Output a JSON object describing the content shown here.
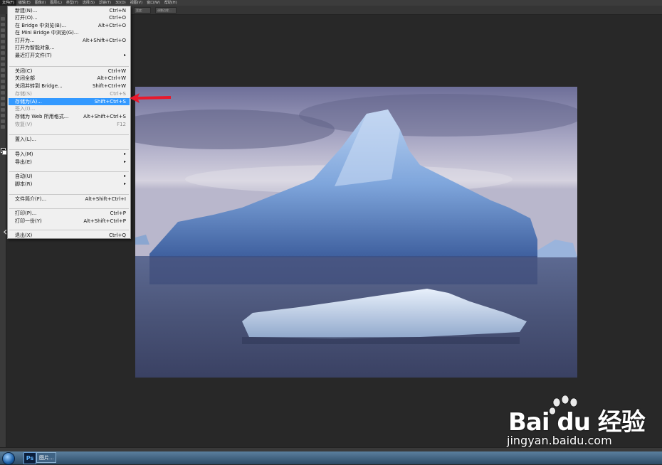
{
  "menubar": {
    "items": [
      {
        "label": "文件(F)",
        "active": true
      },
      {
        "label": "编辑(E)"
      },
      {
        "label": "图像(I)"
      },
      {
        "label": "图层(L)"
      },
      {
        "label": "类型(Y)"
      },
      {
        "label": "选择(S)"
      },
      {
        "label": "滤镜(T)"
      },
      {
        "label": "3D(D)"
      },
      {
        "label": "视图(V)"
      },
      {
        "label": "窗口(W)"
      },
      {
        "label": "帮助(H)"
      }
    ]
  },
  "options_bar": {
    "field1": "宽度:",
    "field2": "调整边缘..."
  },
  "file_menu": {
    "items": [
      {
        "label": "新建(N)...",
        "shortcut": "Ctrl+N"
      },
      {
        "label": "打开(O)...",
        "shortcut": "Ctrl+O"
      },
      {
        "label": "在 Bridge 中浏览(B)...",
        "shortcut": "Alt+Ctrl+O"
      },
      {
        "label": "在 Mini Bridge 中浏览(G)...",
        "shortcut": ""
      },
      {
        "label": "打开为...",
        "shortcut": "Alt+Shift+Ctrl+O"
      },
      {
        "label": "打开为智能对象...",
        "shortcut": ""
      },
      {
        "label": "最近打开文件(T)",
        "shortcut": "",
        "submenu": true
      },
      {
        "label": "关闭(C)",
        "shortcut": "Ctrl+W"
      },
      {
        "label": "关闭全部",
        "shortcut": "Alt+Ctrl+W"
      },
      {
        "label": "关闭并转到 Bridge...",
        "shortcut": "Shift+Ctrl+W"
      },
      {
        "label": "存储(S)",
        "shortcut": "Ctrl+S",
        "disabled": true
      },
      {
        "label": "存储为(A)...",
        "shortcut": "Shift+Ctrl+S",
        "highlight": true
      },
      {
        "label": "签入(I)...",
        "shortcut": "",
        "disabled": true
      },
      {
        "label": "存储为 Web 所用格式...",
        "shortcut": "Alt+Shift+Ctrl+S"
      },
      {
        "label": "恢复(V)",
        "shortcut": "F12",
        "disabled": true
      },
      {
        "label": "置入(L)...",
        "shortcut": ""
      },
      {
        "label": "导入(M)",
        "shortcut": "",
        "submenu": true
      },
      {
        "label": "导出(E)",
        "shortcut": "",
        "submenu": true
      },
      {
        "label": "自动(U)",
        "shortcut": "",
        "submenu": true
      },
      {
        "label": "脚本(R)",
        "shortcut": "",
        "submenu": true
      },
      {
        "label": "文件简介(F)...",
        "shortcut": "Alt+Shift+Ctrl+I"
      },
      {
        "label": "打印(P)...",
        "shortcut": "Ctrl+P"
      },
      {
        "label": "打印一份(Y)",
        "shortcut": "Alt+Shift+Ctrl+P"
      },
      {
        "label": "退出(X)",
        "shortcut": "Ctrl+Q"
      }
    ],
    "submenu_arrow": "▸"
  },
  "colors": {
    "highlight": "#3399ff",
    "annotation_arrow": "#e8192c",
    "workspace": "#282828"
  },
  "taskbar": {
    "ps_label": "Ps",
    "image_task_label": "图片..."
  },
  "watermark": {
    "brand": "Bai du 经验",
    "site": "jingyan.baidu.com"
  }
}
